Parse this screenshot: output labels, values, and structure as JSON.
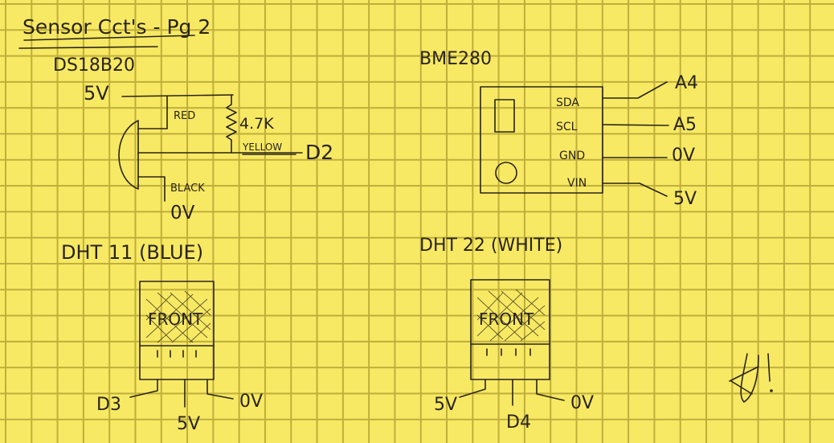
{
  "title": "Sensor Cct's - Pg 2",
  "ds18b20": {
    "label": "DS18B20",
    "supply": "5V",
    "wire_red": "RED",
    "resistor": "4.7K",
    "wire_yellow": "YELLOW",
    "pin_data": "D2",
    "wire_black": "BLACK",
    "ground": "0V"
  },
  "bme280": {
    "label": "BME280",
    "pins": [
      {
        "name": "SDA",
        "to": "A4"
      },
      {
        "name": "SCL",
        "to": "A5"
      },
      {
        "name": "GND",
        "to": "0V"
      },
      {
        "name": "VIN",
        "to": "5V"
      }
    ]
  },
  "dht11": {
    "label": "DHT 11 (BLUE)",
    "front": "FRONT",
    "pin_left": "D3",
    "pin_middle": "5V",
    "pin_right": "0V"
  },
  "dht22": {
    "label": "DHT 22 (WHITE)",
    "front": "FRONT",
    "pin_left": "5V",
    "pin_middle": "D4",
    "pin_right": "0V"
  },
  "signature": "A!"
}
